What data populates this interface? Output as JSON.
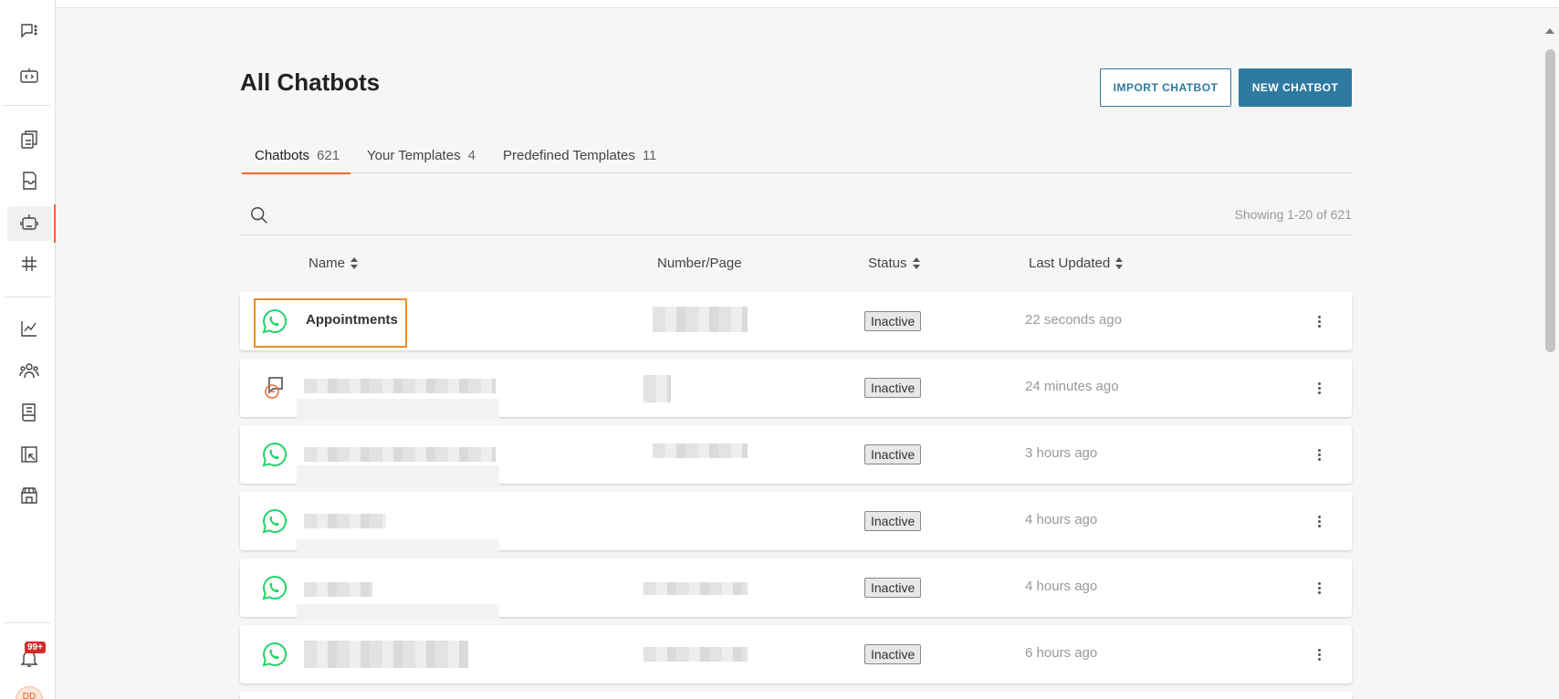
{
  "page": {
    "title": "All Chatbots",
    "import_label": "IMPORT CHATBOT",
    "new_label": "NEW CHATBOT"
  },
  "tabs": [
    {
      "label": "Chatbots",
      "count": "621",
      "active": true
    },
    {
      "label": "Your Templates",
      "count": "4",
      "active": false
    },
    {
      "label": "Predefined Templates",
      "count": "11",
      "active": false
    }
  ],
  "search": {
    "placeholder": "",
    "showing": "Showing 1-20 of 621"
  },
  "columns": {
    "name": "Name",
    "number": "Number/Page",
    "status": "Status",
    "updated": "Last Updated"
  },
  "rows": [
    {
      "icon": "whatsapp-icon",
      "name": "Appointments",
      "status": "Inactive",
      "updated": "22 seconds ago"
    },
    {
      "icon": "messenger-bot-icon",
      "name": "",
      "status": "Inactive",
      "updated": "24 minutes ago"
    },
    {
      "icon": "whatsapp-icon",
      "name": "",
      "status": "Inactive",
      "updated": "3 hours ago"
    },
    {
      "icon": "whatsapp-icon",
      "name": "",
      "status": "Inactive",
      "updated": "4 hours ago"
    },
    {
      "icon": "whatsapp-icon",
      "name": "",
      "status": "Inactive",
      "updated": "4 hours ago"
    },
    {
      "icon": "whatsapp-icon",
      "name": "",
      "status": "Inactive",
      "updated": "6 hours ago"
    }
  ],
  "notifications": {
    "badge": "99+"
  },
  "avatar": {
    "initials": "DD"
  },
  "colors": {
    "accent": "#f06a2a",
    "primary": "#2e7aa0",
    "whatsapp": "#25d366"
  },
  "rail_icons": [
    "chat-icon",
    "code-bot-icon",
    "copy-doc-icon",
    "inbox-icon",
    "chatbot-icon",
    "hashtag-icon",
    "analytics-icon",
    "contacts-icon",
    "book-icon",
    "campaign-icon",
    "store-icon",
    "bell-icon"
  ]
}
